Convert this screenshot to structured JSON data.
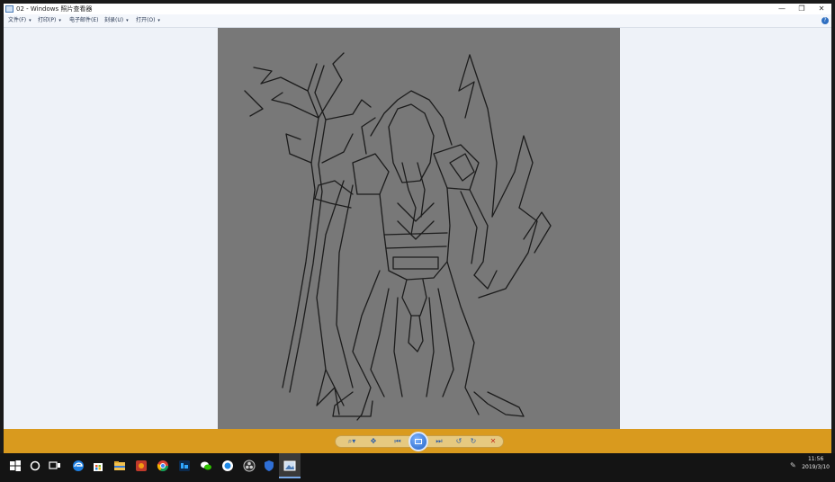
{
  "window": {
    "title": "02 - Windows 照片查看器",
    "controls": {
      "minimize": "—",
      "restore": "❐",
      "close": "✕"
    }
  },
  "menu": {
    "items": [
      {
        "label": "文件(F)"
      },
      {
        "label": "打印(P)"
      },
      {
        "label": "电子邮件(E)"
      },
      {
        "label": "刻录(U)"
      },
      {
        "label": "打开(O)"
      }
    ],
    "caret": "▾",
    "help": "?"
  },
  "controls": {
    "zoom": "⌕▾",
    "fit": "✥",
    "prev": "⏮",
    "next": "⏭",
    "rotate_ccw": "↺",
    "rotate_cw": "↻",
    "delete": "✕"
  },
  "taskbar": {
    "time": "11:56",
    "date": "2019/3/10"
  },
  "colors": {
    "control_bar": "#d99a1e",
    "image_background": "#787878",
    "viewer_background": "#eef2f8"
  }
}
